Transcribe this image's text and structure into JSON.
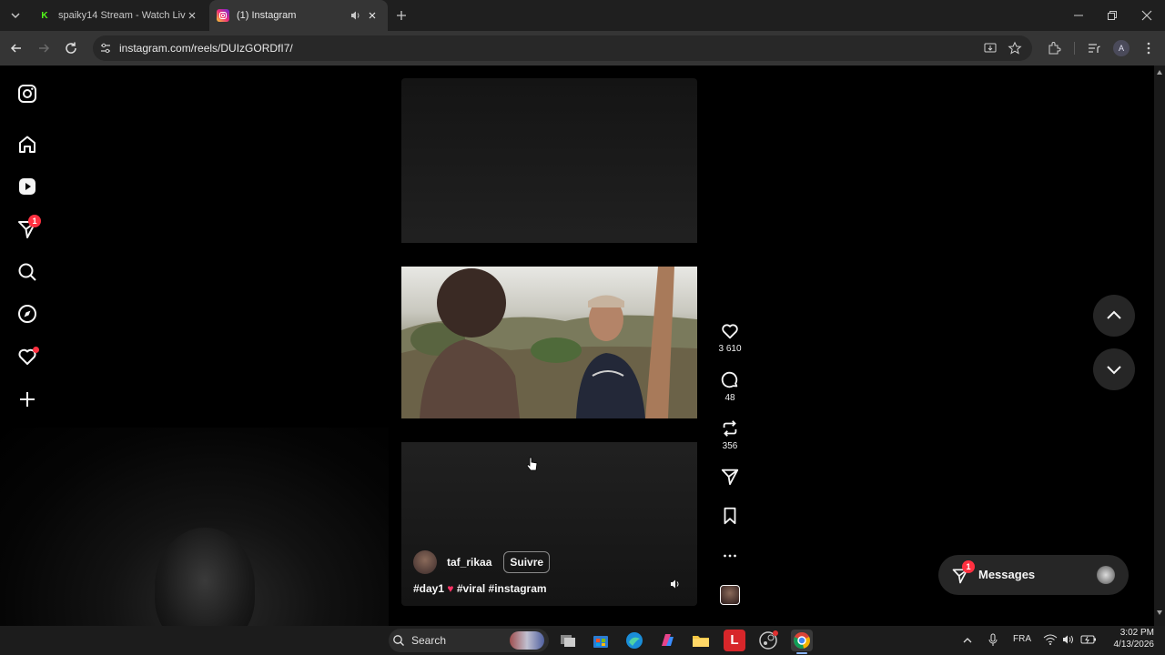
{
  "browser": {
    "tabs": [
      {
        "title": "spaiky14 Stream - Watch Live o",
        "favicon_letter": "K",
        "active": false
      },
      {
        "title": "(1) Instagram",
        "active": true
      }
    ],
    "url": "instagram.com/reels/DUIzGORDfI7/",
    "profile_initial": "A"
  },
  "sidebar": {
    "items": [
      {
        "icon": "instagram-logo-icon"
      },
      {
        "icon": "home-icon"
      },
      {
        "icon": "reels-icon"
      },
      {
        "icon": "messages-icon",
        "badge": "1"
      },
      {
        "icon": "search-icon"
      },
      {
        "icon": "explore-icon"
      },
      {
        "icon": "notifications-icon",
        "dot": true
      },
      {
        "icon": "create-icon"
      }
    ]
  },
  "reel": {
    "username": "taf_rikaa",
    "follow_label": "Suivre",
    "caption_part1": "#day1",
    "caption_part2": "#viral #instagram",
    "actions": {
      "likes": "3 610",
      "comments": "48",
      "reposts": "356"
    }
  },
  "messages_bar": {
    "label": "Messages",
    "badge": "1"
  },
  "taskbar": {
    "search_placeholder": "Search",
    "language": "FRA",
    "time": "3:02 PM",
    "date": "4/13/2026"
  },
  "colors": {
    "badge_red": "#ff3040",
    "heart_pink": "#ff3366",
    "kick_green": "#53fc18"
  }
}
